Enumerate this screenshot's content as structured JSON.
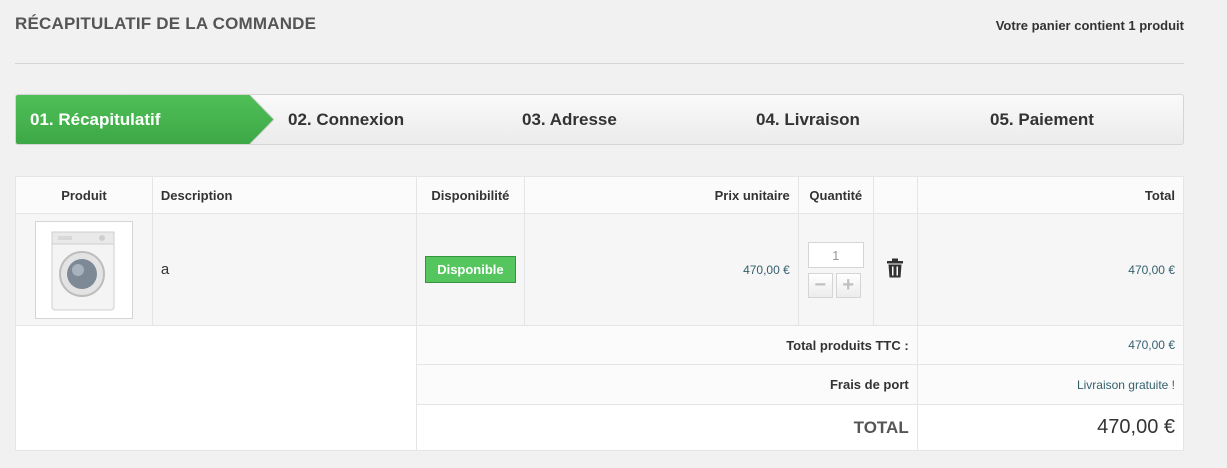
{
  "header": {
    "title": "RÉCAPITULATIF DE LA COMMANDE",
    "cart_summary": "Votre panier contient 1 produit"
  },
  "steps": [
    {
      "label": "01. Récapitulatif",
      "active": true
    },
    {
      "label": "02. Connexion",
      "active": false
    },
    {
      "label": "03. Adresse",
      "active": false
    },
    {
      "label": "04. Livraison",
      "active": false
    },
    {
      "label": "05. Paiement",
      "active": false
    }
  ],
  "table": {
    "columns": {
      "product": "Produit",
      "description": "Description",
      "availability": "Disponibilité",
      "unit_price": "Prix unitaire",
      "quantity": "Quantité",
      "total": "Total"
    },
    "item": {
      "image_icon": "washing-machine-image",
      "description": "a",
      "availability": "Disponible",
      "unit_price": "470,00 €",
      "quantity": "1",
      "total": "470,00 €"
    },
    "summary": {
      "products_label": "Total produits TTC :",
      "products_value": "470,00 €",
      "shipping_label": "Frais de port",
      "shipping_value": "Livraison gratuite !",
      "total_label": "TOTAL",
      "total_value": "470,00 €"
    }
  },
  "colors": {
    "active_step": "#46a74e",
    "badge": "#55c65e",
    "price": "#34606e"
  }
}
